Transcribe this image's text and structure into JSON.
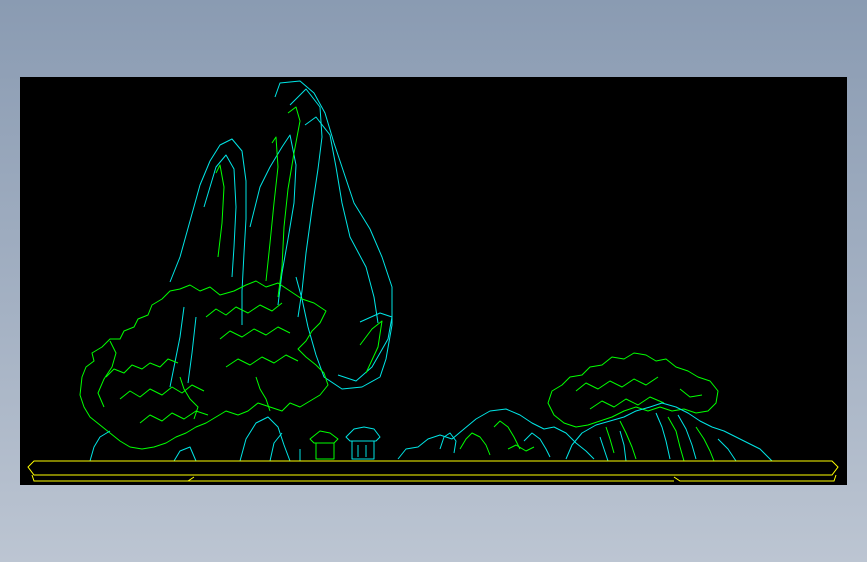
{
  "colors": {
    "background_top": "#8a9bb2",
    "background_bottom": "#bcc5d2",
    "canvas": "#000000",
    "cyan": "#00e5e5",
    "green": "#00ff00",
    "yellow": "#ffff00"
  },
  "icons": {
    "mountain": "rock-mountain-outline-icon",
    "trees": "tree-foliage-outline-icon",
    "pavilion": "pavilion-building-icon",
    "tray": "basin-tray-outline-icon"
  }
}
